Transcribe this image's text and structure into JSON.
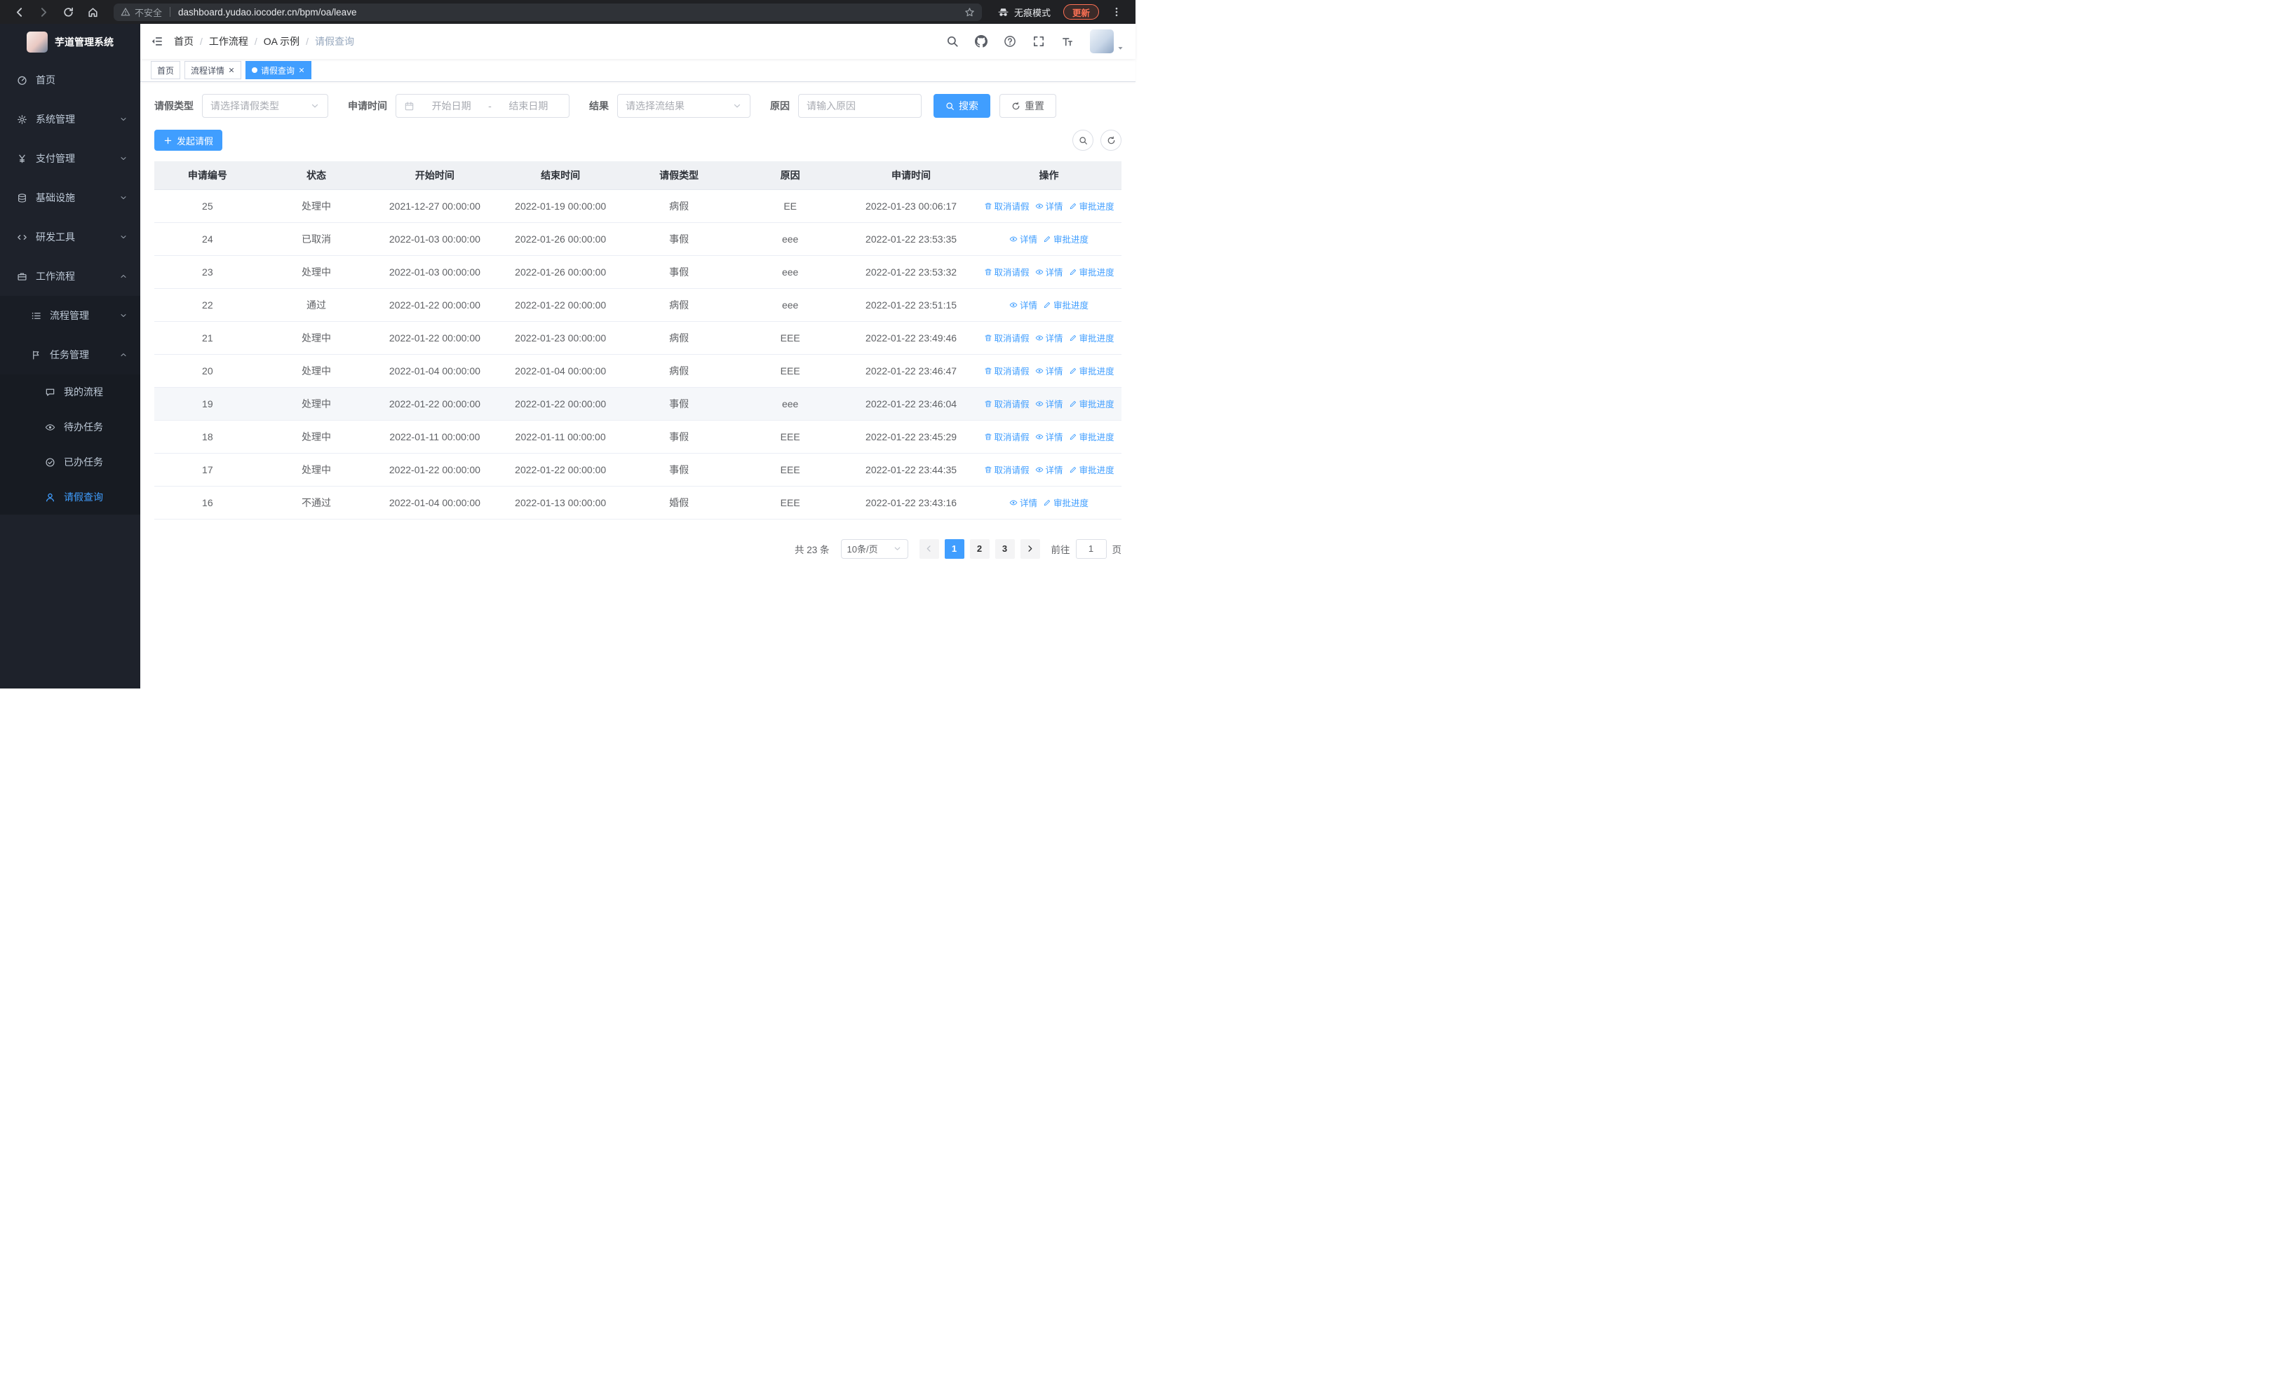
{
  "browser": {
    "security_warning": "不安全",
    "url": "dashboard.yudao.iocoder.cn/bpm/oa/leave",
    "incognito_label": "无痕模式",
    "update_label": "更新"
  },
  "sidebar": {
    "app_title": "芋道管理系统",
    "items": [
      {
        "label": "首页",
        "icon": "dashboard-icon"
      },
      {
        "label": "系统管理",
        "icon": "gear-icon"
      },
      {
        "label": "支付管理",
        "icon": "yen-icon"
      },
      {
        "label": "基础设施",
        "icon": "infrastructure-icon"
      },
      {
        "label": "研发工具",
        "icon": "code-icon"
      },
      {
        "label": "工作流程",
        "icon": "briefcase-icon",
        "expanded": true
      },
      {
        "label": "流程管理",
        "icon": "list-icon"
      },
      {
        "label": "任务管理",
        "icon": "flag-icon",
        "expanded": true
      },
      {
        "label": "我的流程",
        "icon": "chat-icon"
      },
      {
        "label": "待办任务",
        "icon": "eye-icon"
      },
      {
        "label": "已办任务",
        "icon": "check-circle-icon"
      },
      {
        "label": "请假查询",
        "icon": "user-icon",
        "active": true
      }
    ]
  },
  "breadcrumb": {
    "separator": "/",
    "items": [
      "首页",
      "工作流程",
      "OA 示例",
      "请假查询"
    ]
  },
  "tabs": [
    {
      "label": "首页",
      "active": false,
      "closable": false
    },
    {
      "label": "流程详情",
      "active": false,
      "closable": true
    },
    {
      "label": "请假查询",
      "active": true,
      "closable": true
    }
  ],
  "filters": {
    "leave_type_label": "请假类型",
    "leave_type_placeholder": "请选择请假类型",
    "apply_time_label": "申请时间",
    "start_date_placeholder": "开始日期",
    "date_separator": "-",
    "end_date_placeholder": "结束日期",
    "result_label": "结果",
    "result_placeholder": "请选择流结果",
    "reason_label": "原因",
    "reason_placeholder": "请输入原因",
    "search_button": "搜索",
    "reset_button": "重置"
  },
  "toolbar": {
    "create_button": "发起请假"
  },
  "table": {
    "headers": [
      "申请编号",
      "状态",
      "开始时间",
      "结束时间",
      "请假类型",
      "原因",
      "申请时间",
      "操作"
    ],
    "actions": {
      "cancel": "取消请假",
      "detail": "详情",
      "progress": "审批进度"
    },
    "rows": [
      {
        "id": "25",
        "status": "处理中",
        "start": "2021-12-27 00:00:00",
        "end": "2022-01-19 00:00:00",
        "type": "病假",
        "reason": "EE",
        "applied": "2022-01-23 00:06:17",
        "can_cancel": true,
        "hovered": false
      },
      {
        "id": "24",
        "status": "已取消",
        "start": "2022-01-03 00:00:00",
        "end": "2022-01-26 00:00:00",
        "type": "事假",
        "reason": "eee",
        "applied": "2022-01-22 23:53:35",
        "can_cancel": false,
        "hovered": false
      },
      {
        "id": "23",
        "status": "处理中",
        "start": "2022-01-03 00:00:00",
        "end": "2022-01-26 00:00:00",
        "type": "事假",
        "reason": "eee",
        "applied": "2022-01-22 23:53:32",
        "can_cancel": true,
        "hovered": false
      },
      {
        "id": "22",
        "status": "通过",
        "start": "2022-01-22 00:00:00",
        "end": "2022-01-22 00:00:00",
        "type": "病假",
        "reason": "eee",
        "applied": "2022-01-22 23:51:15",
        "can_cancel": false,
        "hovered": false
      },
      {
        "id": "21",
        "status": "处理中",
        "start": "2022-01-22 00:00:00",
        "end": "2022-01-23 00:00:00",
        "type": "病假",
        "reason": "EEE",
        "applied": "2022-01-22 23:49:46",
        "can_cancel": true,
        "hovered": false
      },
      {
        "id": "20",
        "status": "处理中",
        "start": "2022-01-04 00:00:00",
        "end": "2022-01-04 00:00:00",
        "type": "病假",
        "reason": "EEE",
        "applied": "2022-01-22 23:46:47",
        "can_cancel": true,
        "hovered": false
      },
      {
        "id": "19",
        "status": "处理中",
        "start": "2022-01-22 00:00:00",
        "end": "2022-01-22 00:00:00",
        "type": "事假",
        "reason": "eee",
        "applied": "2022-01-22 23:46:04",
        "can_cancel": true,
        "hovered": true
      },
      {
        "id": "18",
        "status": "处理中",
        "start": "2022-01-11 00:00:00",
        "end": "2022-01-11 00:00:00",
        "type": "事假",
        "reason": "EEE",
        "applied": "2022-01-22 23:45:29",
        "can_cancel": true,
        "hovered": false
      },
      {
        "id": "17",
        "status": "处理中",
        "start": "2022-01-22 00:00:00",
        "end": "2022-01-22 00:00:00",
        "type": "事假",
        "reason": "EEE",
        "applied": "2022-01-22 23:44:35",
        "can_cancel": true,
        "hovered": false
      },
      {
        "id": "16",
        "status": "不通过",
        "start": "2022-01-04 00:00:00",
        "end": "2022-01-13 00:00:00",
        "type": "婚假",
        "reason": "EEE",
        "applied": "2022-01-22 23:43:16",
        "can_cancel": false,
        "hovered": false
      }
    ]
  },
  "pagination": {
    "total": "共 23 条",
    "page_size": "10条/页",
    "pages": [
      "1",
      "2",
      "3"
    ],
    "active_page": "1",
    "goto_label": "前往",
    "goto_value": "1",
    "page_unit": "页"
  },
  "colors": {
    "primary": "#409eff",
    "sidebar_bg": "#1e222b",
    "submenu_bg": "#191d25",
    "tab_active_bg": "#409eff",
    "update_accent": "#ff7154",
    "table_header_bg": "#eff1f4",
    "hover_row_bg": "#f5f7fa"
  }
}
